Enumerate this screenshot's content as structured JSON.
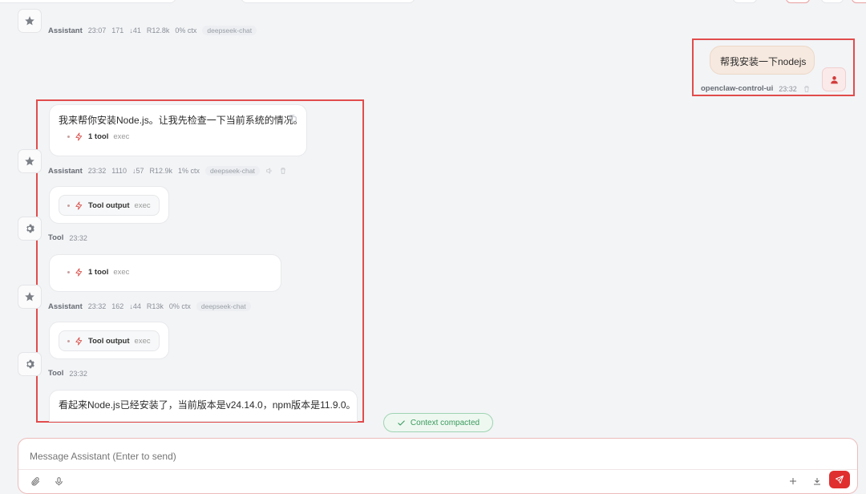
{
  "messages": {
    "m0": {
      "sender": "Assistant",
      "time": "23:07",
      "in_tokens": "171",
      "out_tokens": "↓41",
      "cache": "R12.8k",
      "ctx": "0% ctx",
      "model": "deepseek-chat"
    },
    "user": {
      "text": "帮我安装一下nodejs",
      "sender": "openclaw-control-ui",
      "time": "23:32"
    },
    "m1": {
      "text": "我来帮你安装Node.js。让我先检查一下当前系统的情况。",
      "tool_label": "1 tool",
      "tool_sub": "exec",
      "sender": "Assistant",
      "time": "23:32",
      "in_tokens": "1110",
      "out_tokens": "↓57",
      "cache": "R12.9k",
      "ctx": "1% ctx",
      "model": "deepseek-chat"
    },
    "t1": {
      "tool_label": "Tool output",
      "tool_sub": "exec",
      "sender": "Tool",
      "time": "23:32"
    },
    "m2": {
      "tool_label": "1 tool",
      "tool_sub": "exec",
      "sender": "Assistant",
      "time": "23:32",
      "in_tokens": "162",
      "out_tokens": "↓44",
      "cache": "R13k",
      "ctx": "0% ctx",
      "model": "deepseek-chat"
    },
    "t2": {
      "tool_label": "Tool output",
      "tool_sub": "exec",
      "sender": "Tool",
      "time": "23:32"
    },
    "m3": {
      "text": "看起来Node.js已经安装了，当前版本是v24.14.0，npm版本是11.9.0。"
    }
  },
  "context_badge": "Context compacted",
  "composer": {
    "placeholder": "Message Assistant (Enter to send)"
  },
  "colors": {
    "accent_red": "#e02f2f",
    "highlight_box": "#e24c4c",
    "context_green": "#3a9a5c",
    "user_bubble": "#f6e9df"
  }
}
